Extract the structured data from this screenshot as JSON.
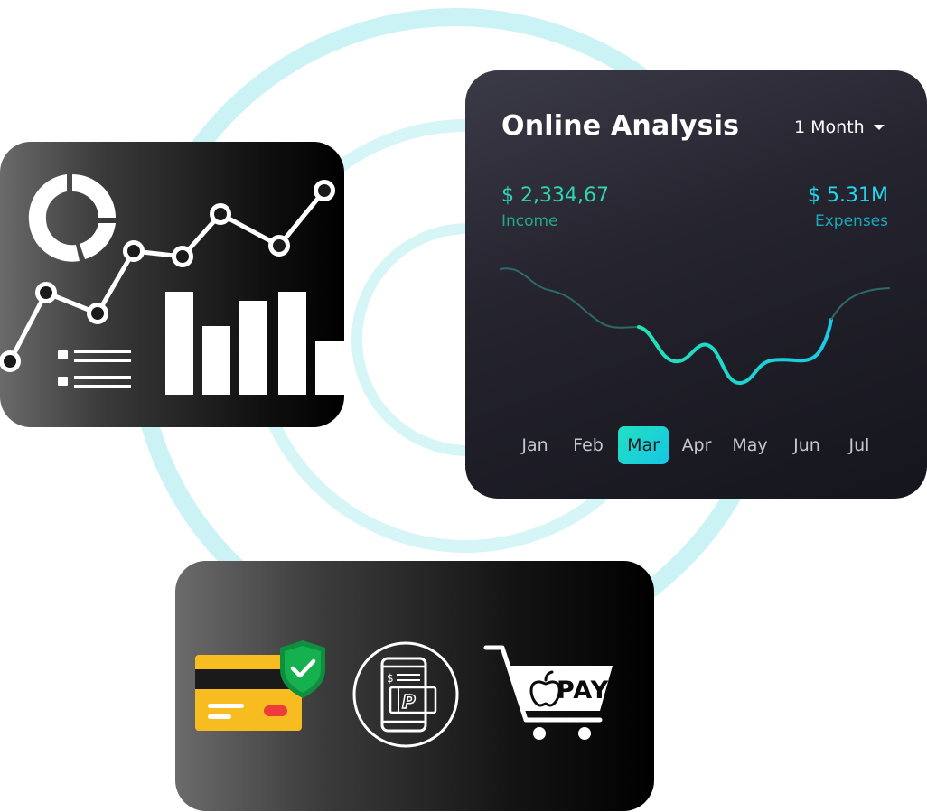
{
  "online_analysis": {
    "title": "Online Analysis",
    "period": "1 Month",
    "income": {
      "value": "$ 2,334,67",
      "label": "Income"
    },
    "expenses": {
      "value": "$ 5.31M",
      "label": "Expenses"
    },
    "months": [
      "Jan",
      "Feb",
      "Mar",
      "Apr",
      "May",
      "Jun",
      "Jul"
    ],
    "active_month": "Mar",
    "accent_colors": {
      "income": "#2fd5b5",
      "expenses": "#20d9ee",
      "active": "#23e0c0"
    }
  },
  "analytics_card": {
    "icons": [
      "donut-chart-icon",
      "line-chart-icon",
      "bar-chart-icon",
      "list-icon"
    ]
  },
  "payments_card": {
    "icons": [
      "credit-card-icon",
      "security-shield-icon",
      "mobile-paypal-icon",
      "shopping-cart-icon",
      "apple-logo-icon"
    ],
    "pay_label": "PAY"
  },
  "colors": {
    "ring": "#c9f1f3",
    "card_dark": "#1c1b24",
    "credit_card": "#f7bc1f",
    "shield": "#12a84a"
  }
}
